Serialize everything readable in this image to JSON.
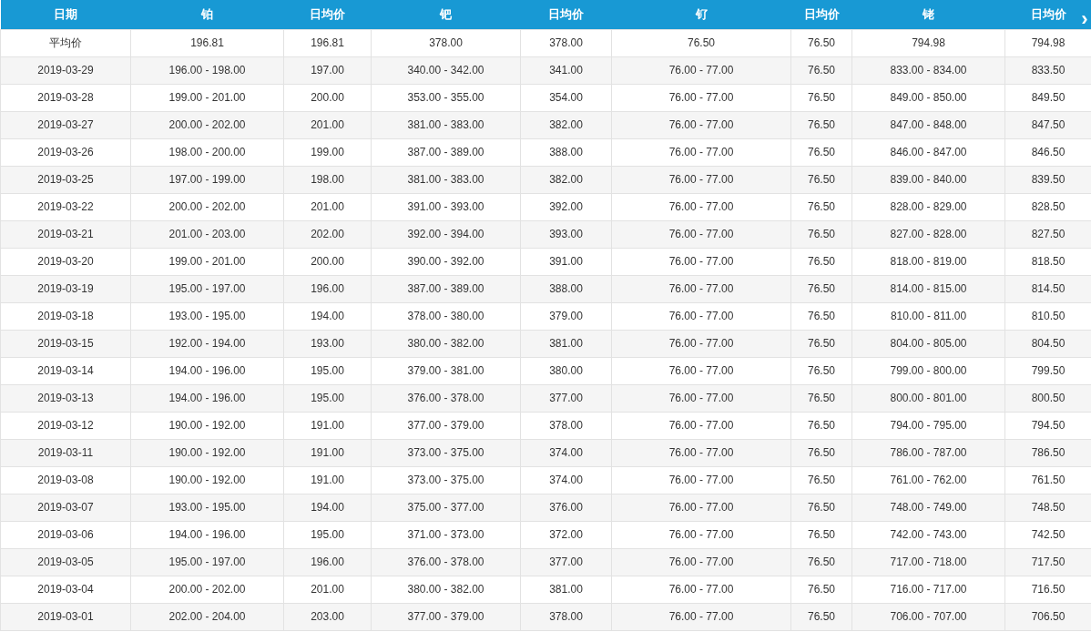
{
  "table": {
    "columns": [
      "日期",
      "铂",
      "日均价",
      "钯",
      "日均价",
      "钌",
      "日均价",
      "铑",
      "日均价"
    ],
    "scroll_button": "›",
    "rows": [
      [
        "平均价",
        "196.81",
        "196.81",
        "378.00",
        "378.00",
        "76.50",
        "76.50",
        "794.98",
        "794.98"
      ],
      [
        "2019-03-29",
        "196.00 - 198.00",
        "197.00",
        "340.00 - 342.00",
        "341.00",
        "76.00 - 77.00",
        "76.50",
        "833.00 - 834.00",
        "833.50"
      ],
      [
        "2019-03-28",
        "199.00 - 201.00",
        "200.00",
        "353.00 - 355.00",
        "354.00",
        "76.00 - 77.00",
        "76.50",
        "849.00 - 850.00",
        "849.50"
      ],
      [
        "2019-03-27",
        "200.00 - 202.00",
        "201.00",
        "381.00 - 383.00",
        "382.00",
        "76.00 - 77.00",
        "76.50",
        "847.00 - 848.00",
        "847.50"
      ],
      [
        "2019-03-26",
        "198.00 - 200.00",
        "199.00",
        "387.00 - 389.00",
        "388.00",
        "76.00 - 77.00",
        "76.50",
        "846.00 - 847.00",
        "846.50"
      ],
      [
        "2019-03-25",
        "197.00 - 199.00",
        "198.00",
        "381.00 - 383.00",
        "382.00",
        "76.00 - 77.00",
        "76.50",
        "839.00 - 840.00",
        "839.50"
      ],
      [
        "2019-03-22",
        "200.00 - 202.00",
        "201.00",
        "391.00 - 393.00",
        "392.00",
        "76.00 - 77.00",
        "76.50",
        "828.00 - 829.00",
        "828.50"
      ],
      [
        "2019-03-21",
        "201.00 - 203.00",
        "202.00",
        "392.00 - 394.00",
        "393.00",
        "76.00 - 77.00",
        "76.50",
        "827.00 - 828.00",
        "827.50"
      ],
      [
        "2019-03-20",
        "199.00 - 201.00",
        "200.00",
        "390.00 - 392.00",
        "391.00",
        "76.00 - 77.00",
        "76.50",
        "818.00 - 819.00",
        "818.50"
      ],
      [
        "2019-03-19",
        "195.00 - 197.00",
        "196.00",
        "387.00 - 389.00",
        "388.00",
        "76.00 - 77.00",
        "76.50",
        "814.00 - 815.00",
        "814.50"
      ],
      [
        "2019-03-18",
        "193.00 - 195.00",
        "194.00",
        "378.00 - 380.00",
        "379.00",
        "76.00 - 77.00",
        "76.50",
        "810.00 - 811.00",
        "810.50"
      ],
      [
        "2019-03-15",
        "192.00 - 194.00",
        "193.00",
        "380.00 - 382.00",
        "381.00",
        "76.00 - 77.00",
        "76.50",
        "804.00 - 805.00",
        "804.50"
      ],
      [
        "2019-03-14",
        "194.00 - 196.00",
        "195.00",
        "379.00 - 381.00",
        "380.00",
        "76.00 - 77.00",
        "76.50",
        "799.00 - 800.00",
        "799.50"
      ],
      [
        "2019-03-13",
        "194.00 - 196.00",
        "195.00",
        "376.00 - 378.00",
        "377.00",
        "76.00 - 77.00",
        "76.50",
        "800.00 - 801.00",
        "800.50"
      ],
      [
        "2019-03-12",
        "190.00 - 192.00",
        "191.00",
        "377.00 - 379.00",
        "378.00",
        "76.00 - 77.00",
        "76.50",
        "794.00 - 795.00",
        "794.50"
      ],
      [
        "2019-03-11",
        "190.00 - 192.00",
        "191.00",
        "373.00 - 375.00",
        "374.00",
        "76.00 - 77.00",
        "76.50",
        "786.00 - 787.00",
        "786.50"
      ],
      [
        "2019-03-08",
        "190.00 - 192.00",
        "191.00",
        "373.00 - 375.00",
        "374.00",
        "76.00 - 77.00",
        "76.50",
        "761.00 - 762.00",
        "761.50"
      ],
      [
        "2019-03-07",
        "193.00 - 195.00",
        "194.00",
        "375.00 - 377.00",
        "376.00",
        "76.00 - 77.00",
        "76.50",
        "748.00 - 749.00",
        "748.50"
      ],
      [
        "2019-03-06",
        "194.00 - 196.00",
        "195.00",
        "371.00 - 373.00",
        "372.00",
        "76.00 - 77.00",
        "76.50",
        "742.00 - 743.00",
        "742.50"
      ],
      [
        "2019-03-05",
        "195.00 - 197.00",
        "196.00",
        "376.00 - 378.00",
        "377.00",
        "76.00 - 77.00",
        "76.50",
        "717.00 - 718.00",
        "717.50"
      ],
      [
        "2019-03-04",
        "200.00 - 202.00",
        "201.00",
        "380.00 - 382.00",
        "381.00",
        "76.00 - 77.00",
        "76.50",
        "716.00 - 717.00",
        "716.50"
      ],
      [
        "2019-03-01",
        "202.00 - 204.00",
        "203.00",
        "377.00 - 379.00",
        "378.00",
        "76.00 - 77.00",
        "76.50",
        "706.00 - 707.00",
        "706.50"
      ]
    ]
  }
}
